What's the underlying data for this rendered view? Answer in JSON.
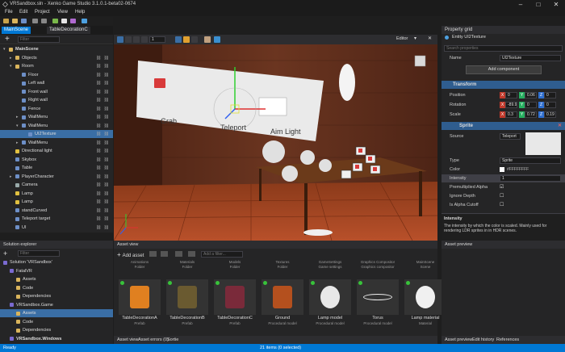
{
  "window": {
    "title": "VRSandbox.sln - Xenko Game Studio 3.1.0.1-beta02-0674",
    "min": "–",
    "max": "□",
    "close": "✕"
  },
  "menu": [
    "File",
    "Edit",
    "Project",
    "View",
    "Help"
  ],
  "doc_tabs": [
    "MainScene",
    "TableDecorationC"
  ],
  "scene": {
    "filter_placeholder": "Filter",
    "items": [
      {
        "label": "MainScene",
        "depth": 0,
        "expanded": true,
        "icon": "scene-icon"
      },
      {
        "label": "Objects",
        "depth": 1,
        "expanded": false,
        "icon": "folder-icon"
      },
      {
        "label": "Room",
        "depth": 1,
        "expanded": true,
        "icon": "folder-icon"
      },
      {
        "label": "Floor",
        "depth": 2,
        "icon": "entity-icon"
      },
      {
        "label": "Left wall",
        "depth": 2,
        "icon": "entity-icon"
      },
      {
        "label": "Front wall",
        "depth": 2,
        "icon": "entity-icon"
      },
      {
        "label": "Right wall",
        "depth": 2,
        "icon": "entity-icon"
      },
      {
        "label": "Fence",
        "depth": 2,
        "icon": "entity-icon"
      },
      {
        "label": "WallMenu",
        "depth": 2,
        "expanded": false,
        "icon": "entity-icon"
      },
      {
        "label": "WallMenu",
        "depth": 2,
        "expanded": true,
        "icon": "entity-icon"
      },
      {
        "label": "UI2Texture",
        "depth": 3,
        "icon": "entity-icon",
        "selected": true
      },
      {
        "label": "WallMenu",
        "depth": 2,
        "expanded": false,
        "icon": "entity-icon"
      },
      {
        "label": "Directional light",
        "depth": 1,
        "icon": "light-icon"
      },
      {
        "label": "Skybox",
        "depth": 1,
        "icon": "entity-icon"
      },
      {
        "label": "Table",
        "depth": 1,
        "icon": "entity-icon"
      },
      {
        "label": "PlayerCharacter",
        "depth": 1,
        "expanded": false,
        "icon": "entity-icon"
      },
      {
        "label": "Camera",
        "depth": 1,
        "icon": "camera-icon"
      },
      {
        "label": "Lamp",
        "depth": 1,
        "icon": "light-icon"
      },
      {
        "label": "Lamp",
        "depth": 1,
        "icon": "light-icon"
      },
      {
        "label": "standCurved",
        "depth": 1,
        "icon": "entity-icon"
      },
      {
        "label": "Teleport target",
        "depth": 1,
        "icon": "entity-icon"
      },
      {
        "label": "UI",
        "depth": 1,
        "icon": "entity-icon"
      }
    ]
  },
  "viewport": {
    "zoom_value": "1",
    "camera_mode": "Editor",
    "billboard": {
      "grab": "Grab",
      "teleport": "Teleport",
      "aim": "Aim Light"
    }
  },
  "properties": {
    "header": "Property grid",
    "entity_title": "Entity UI2Texture",
    "search_placeholder": "Search properties",
    "name_label": "Name",
    "name_value": "UI2Texture",
    "add_component": "Add component",
    "transform": {
      "title": "Transform",
      "position": {
        "label": "Position",
        "x": "0",
        "y": "0.06",
        "z": "0"
      },
      "rotation": {
        "label": "Rotation",
        "x": "-89.96",
        "y": "0",
        "z": "0"
      },
      "scale": {
        "label": "Scale",
        "x": "0.3",
        "y": "0.72",
        "z": "0.19"
      }
    },
    "sprite": {
      "title": "Sprite",
      "source_label": "Source",
      "source_value": "Teleport",
      "type_label": "Type",
      "type_value": "Sprite",
      "color_label": "Color",
      "color_value": "#FFFFFFFF",
      "intensity_label": "Intensity",
      "intensity_value": "1",
      "premultiplied_label": "Premultiplied Alpha",
      "ignore_depth_label": "Ignore Depth",
      "alpha_cutoff_label": "Is Alpha Cutoff"
    },
    "help_title": "Intensity",
    "help_text": "The intensity by which the color is scaled. Mainly used for rendering LDR sprites in in HDR scenes."
  },
  "solution": {
    "header": "Solution explorer",
    "filter_placeholder": "Filter",
    "items": [
      {
        "label": "Solution 'VRSandbox'",
        "depth": 0,
        "bold": false
      },
      {
        "label": "FatalVR",
        "depth": 1,
        "bold": false
      },
      {
        "label": "Assets",
        "depth": 2,
        "bold": false
      },
      {
        "label": "Code",
        "depth": 2,
        "bold": false
      },
      {
        "label": "Dependencies",
        "depth": 2,
        "bold": false
      },
      {
        "label": "VRSandbox.Game",
        "depth": 1,
        "bold": false
      },
      {
        "label": "Assets",
        "depth": 2,
        "bold": false,
        "selected": true
      },
      {
        "label": "Code",
        "depth": 2,
        "bold": false
      },
      {
        "label": "Dependencies",
        "depth": 2,
        "bold": false
      },
      {
        "label": "VRSandbox.Windows",
        "depth": 1,
        "bold": true
      }
    ]
  },
  "assets": {
    "header": "Asset view",
    "add_asset": "Add asset",
    "filter_placeholder": "Add a filter...",
    "top_row": [
      {
        "name": "Animations",
        "type": "Folder"
      },
      {
        "name": "Materials",
        "type": "Folder"
      },
      {
        "name": "Models",
        "type": "Folder"
      },
      {
        "name": "Textures",
        "type": "Folder"
      },
      {
        "name": "GameSettings",
        "type": "Game settings"
      },
      {
        "name": "Graphics Compositor",
        "type": "Graphics compositor"
      },
      {
        "name": "MainScene",
        "type": "Scene"
      }
    ],
    "cards": [
      {
        "name": "TableDecorationA",
        "type": "Prefab"
      },
      {
        "name": "TableDecorationB",
        "type": "Prefab"
      },
      {
        "name": "TableDecorationC",
        "type": "Prefab"
      },
      {
        "name": "Ground",
        "type": "Procedural model"
      },
      {
        "name": "Lamp model",
        "type": "Procedural model"
      },
      {
        "name": "Torus",
        "type": "Procedural model"
      },
      {
        "name": "Lamp material",
        "type": "Material"
      }
    ],
    "bottom_tabs": [
      "Asset view",
      "Asset errors (0)",
      "Sortie"
    ]
  },
  "asset_preview": {
    "header": "Asset preview",
    "tabs": [
      "Asset preview",
      "Edit history",
      "References"
    ]
  },
  "status": {
    "left": "Ready",
    "center": "21 items (0 selected)"
  },
  "colors": {
    "accent": "#0078d4",
    "selection": "#3a6ea5",
    "panel": "#252526",
    "wall": "#5a2e1c"
  }
}
